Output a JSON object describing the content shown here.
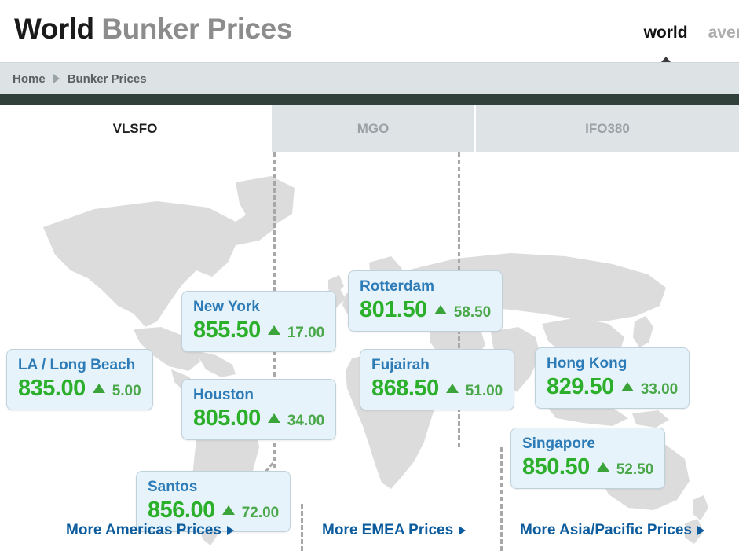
{
  "header": {
    "title_strong": "World",
    "title_light": "Bunker Prices",
    "nav": [
      {
        "label": "world",
        "active": true
      },
      {
        "label": "average",
        "active": false
      }
    ]
  },
  "breadcrumb": {
    "home": "Home",
    "current": "Bunker Prices"
  },
  "tabs": [
    {
      "label": "VLSFO",
      "active": true
    },
    {
      "label": "MGO",
      "active": false
    },
    {
      "label": "IFO380",
      "active": false
    }
  ],
  "prices": [
    {
      "city": "LA / Long Beach",
      "price": "835.00",
      "change": "5.00",
      "direction": "up"
    },
    {
      "city": "New York",
      "price": "855.50",
      "change": "17.00",
      "direction": "up"
    },
    {
      "city": "Houston",
      "price": "805.00",
      "change": "34.00",
      "direction": "up"
    },
    {
      "city": "Santos",
      "price": "856.00",
      "change": "72.00",
      "direction": "up"
    },
    {
      "city": "Rotterdam",
      "price": "801.50",
      "change": "58.50",
      "direction": "up"
    },
    {
      "city": "Fujairah",
      "price": "868.50",
      "change": "51.00",
      "direction": "up"
    },
    {
      "city": "Hong Kong",
      "price": "829.50",
      "change": "33.00",
      "direction": "up"
    },
    {
      "city": "Singapore",
      "price": "850.50",
      "change": "52.50",
      "direction": "up"
    }
  ],
  "more_links": [
    {
      "label": "More Americas Prices"
    },
    {
      "label": "More EMEA Prices"
    },
    {
      "label": "More Asia/Pacific Prices"
    }
  ],
  "colors": {
    "price_green": "#2cb02c",
    "city_blue": "#2d7cb8",
    "link_blue": "#0d5d9e",
    "card_bg": "#e7f3fa",
    "dark_strip": "#32403c",
    "breadcrumb_bg": "#dde3e5"
  }
}
